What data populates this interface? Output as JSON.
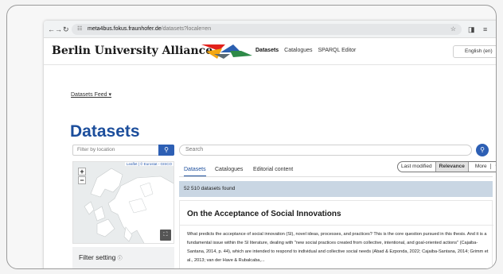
{
  "browser": {
    "url_host": "meta4bus.fokus.fraunhofer.de",
    "url_path": "/datasets?locale=en"
  },
  "header": {
    "brand": "Berlin University Alliance",
    "nav": [
      "Datasets",
      "Catalogues",
      "SPARQL Editor"
    ],
    "language": "English (en)"
  },
  "feed_link": "Datasets Feed",
  "page_title": "Datasets",
  "location_filter": {
    "placeholder": "Filter by location"
  },
  "map": {
    "attribution_leaflet": "Leaflet",
    "attribution_source": "| © Eurostat - GISCO"
  },
  "filter_setting": "Filter setting",
  "search": {
    "placeholder": "Search"
  },
  "tabs": [
    "Datasets",
    "Catalogues",
    "Editorial content"
  ],
  "sort": {
    "options": [
      "Last modified",
      "Relevance",
      "More"
    ],
    "selected": "Relevance"
  },
  "results_count": "52 510 datasets found",
  "result": {
    "title": "On the Acceptance of Social Innovations",
    "description": "What predicts the acceptance of social innovation (SI), novel ideas, processes, and practices? This is the core question pursued in this thesis. And it is a fundamental issue within the SI literature, dealing with \"new social practices created from collective, intentional, and goal-oriented actions\" (Cajaiba-Santana, 2014, p. 44), which are intended to respond to individual and collective social needs (Abad & Ezponda, 2022; Cajaiba-Santana, 2014; Grimm et al., 2013; van der Have & Rubalcaba,..."
  },
  "colors": {
    "accent": "#1c4e9c",
    "button": "#2d5fb4",
    "found_bg": "#c9d6e3"
  }
}
